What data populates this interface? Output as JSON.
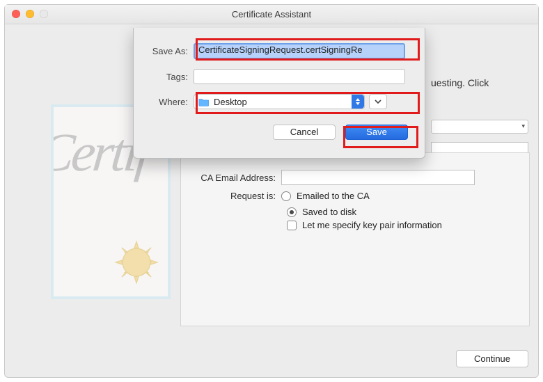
{
  "window": {
    "title": "Certificate Assistant"
  },
  "bg": {
    "hint_fragment": "uesting. Click"
  },
  "cert": {
    "script_text": "Certif"
  },
  "sheet": {
    "save_as_label": "Save As:",
    "save_as_value": "CertificateSigningRequest.certSigningRe",
    "tags_label": "Tags:",
    "where_label": "Where:",
    "where_value": "Desktop",
    "cancel": "Cancel",
    "save": "Save"
  },
  "assistant": {
    "ca_email_label": "CA Email Address:",
    "request_label": "Request is:",
    "opt_emailed": "Emailed to the CA",
    "opt_saved": "Saved to disk",
    "keypair_label": "Let me specify key pair information",
    "continue": "Continue"
  }
}
